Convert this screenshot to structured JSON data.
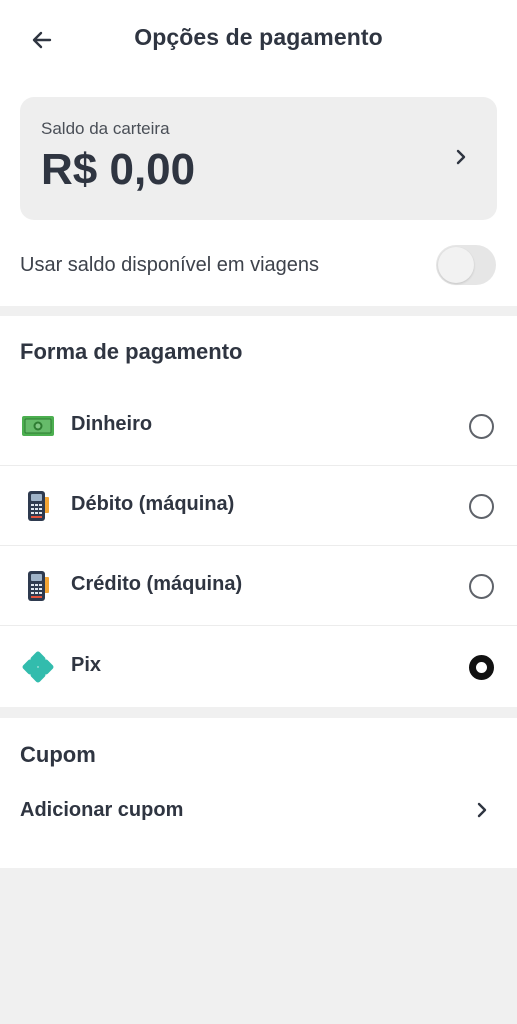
{
  "header": {
    "title": "Opções de pagamento",
    "back_icon": "arrow-left-icon"
  },
  "wallet": {
    "label": "Saldo da carteira",
    "value": "R$ 0,00",
    "chevron_icon": "chevron-right-icon"
  },
  "use_balance": {
    "label": "Usar saldo disponível em viagens",
    "enabled": false
  },
  "payment": {
    "title": "Forma de pagamento",
    "options": [
      {
        "label": "Dinheiro",
        "icon": "cash-icon",
        "selected": false
      },
      {
        "label": "Débito (máquina)",
        "icon": "card-machine-icon",
        "selected": false
      },
      {
        "label": "Crédito (máquina)",
        "icon": "card-machine-icon",
        "selected": false
      },
      {
        "label": "Pix",
        "icon": "pix-icon",
        "selected": true
      }
    ]
  },
  "coupon": {
    "title": "Cupom",
    "add_label": "Adicionar cupom",
    "chevron_icon": "chevron-right-icon"
  },
  "colors": {
    "text": "#2f3541",
    "background": "#f0f0f0",
    "card": "#eeeeee",
    "cash_green": "#4caf50",
    "pix_teal": "#32bcad"
  }
}
